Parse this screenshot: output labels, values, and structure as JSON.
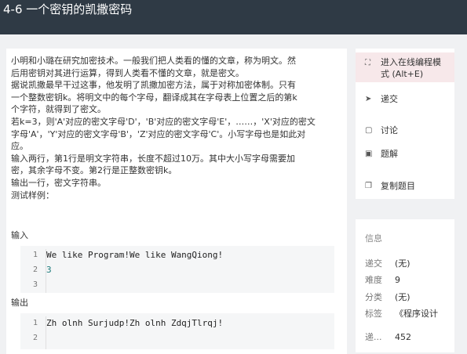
{
  "header": {
    "title": "4-6 一个密钥的凯撒密码"
  },
  "problem": {
    "lines": [
      "小明和小璐在研究加密技术。一般我们把人类看的懂的文章，称为明文。然",
      "后用密钥对其进行运算，得到人类看不懂的文章，就是密文。",
      "据说凯撒最早干过这事，他发明了凯撒加密方法，属于对称加密体制。只有",
      "一个整数密钥k。将明文中的每个字母，翻译成其在字母表上位置之后的第k",
      "个字符，就得到了密文。",
      "若k=3，则'A'对应的密文字母'D'，'B'对应的密文字母'E'，……，'X'对应的密文",
      "字母'A'，'Y'对应的密文字母'B'，'Z'对应的密文字母'C'。小写字母也是如此对",
      "应。",
      "输入两行，第1行是明文字符串，长度不超过10万。其中大小写字母需要加",
      "密，其余字母不变。第2行是正整数密钥k。",
      "输出一行，密文字符串。",
      "测试样例："
    ],
    "input_label": "输入",
    "input_code": [
      {
        "n": "1",
        "text": "We like Program!We like WangQiong!"
      },
      {
        "n": "2",
        "text": "3"
      },
      {
        "n": "3",
        "text": ""
      }
    ],
    "output_label": "输出",
    "output_code": [
      {
        "n": "1",
        "text": "Zh olnh Surjudp!Zh olnh ZdqjTlrqj!"
      },
      {
        "n": "2",
        "text": ""
      }
    ]
  },
  "actions": {
    "online_ide_line1": "进入在线编程模",
    "online_ide_line2": "式 (Alt+E)",
    "submit": "递交",
    "discuss": "讨论",
    "solution": "题解",
    "copy": "复制题目"
  },
  "icons": {
    "expand": "expand-icon",
    "send": "send-icon",
    "comment": "comment-icon",
    "solution": "solution-icon",
    "copy": "copy-icon"
  },
  "info": {
    "title": "信息",
    "rows": [
      {
        "k": "递交",
        "v": "(无)"
      },
      {
        "k": "难度",
        "v": "9"
      },
      {
        "k": "分类",
        "v": "(无)"
      },
      {
        "k": "标签",
        "v": "《程序设计"
      },
      {
        "k": "递...",
        "v": "452"
      }
    ]
  },
  "colors": {
    "header_bg": "#2f3a45",
    "primary_action_bg": "#f7e8ea",
    "page_bg": "#f0f1f3"
  }
}
